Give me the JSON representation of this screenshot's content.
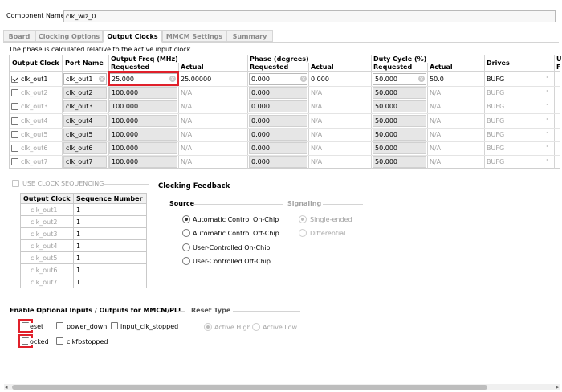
{
  "component": {
    "label": "Component Name",
    "value": "clk_wiz_0"
  },
  "tabs": [
    "Board",
    "Clocking Options",
    "Output Clocks",
    "MMCM Settings",
    "Summary"
  ],
  "active_tab": "Output Clocks",
  "phase_note": "The phase is calculated relative to the active input clock.",
  "table": {
    "headers": {
      "output_clock": "Output Clock",
      "port_name": "Port Name",
      "freq": "Output Freq (MHz)",
      "phase": "Phase (degrees)",
      "duty": "Duty Cycle (%)",
      "drives": "Drives",
      "u": "U",
      "f": "F",
      "requested": "Requested",
      "actual": "Actual"
    },
    "rows": [
      {
        "enabled": true,
        "name": "clk_out1",
        "port": "clk_out1",
        "freq_req": "25.000",
        "freq_act": "25.00000",
        "phase_req": "0.000",
        "phase_act": "0.000",
        "duty_req": "50.000",
        "duty_act": "50.0",
        "drives": "BUFG"
      },
      {
        "enabled": false,
        "name": "clk_out2",
        "port": "clk_out2",
        "freq_req": "100.000",
        "freq_act": "N/A",
        "phase_req": "0.000",
        "phase_act": "N/A",
        "duty_req": "50.000",
        "duty_act": "N/A",
        "drives": "BUFG"
      },
      {
        "enabled": false,
        "name": "clk_out3",
        "port": "clk_out3",
        "freq_req": "100.000",
        "freq_act": "N/A",
        "phase_req": "0.000",
        "phase_act": "N/A",
        "duty_req": "50.000",
        "duty_act": "N/A",
        "drives": "BUFG"
      },
      {
        "enabled": false,
        "name": "clk_out4",
        "port": "clk_out4",
        "freq_req": "100.000",
        "freq_act": "N/A",
        "phase_req": "0.000",
        "phase_act": "N/A",
        "duty_req": "50.000",
        "duty_act": "N/A",
        "drives": "BUFG"
      },
      {
        "enabled": false,
        "name": "clk_out5",
        "port": "clk_out5",
        "freq_req": "100.000",
        "freq_act": "N/A",
        "phase_req": "0.000",
        "phase_act": "N/A",
        "duty_req": "50.000",
        "duty_act": "N/A",
        "drives": "BUFG"
      },
      {
        "enabled": false,
        "name": "clk_out6",
        "port": "clk_out6",
        "freq_req": "100.000",
        "freq_act": "N/A",
        "phase_req": "0.000",
        "phase_act": "N/A",
        "duty_req": "50.000",
        "duty_act": "N/A",
        "drives": "BUFG"
      },
      {
        "enabled": false,
        "name": "clk_out7",
        "port": "clk_out7",
        "freq_req": "100.000",
        "freq_act": "N/A",
        "phase_req": "0.000",
        "phase_act": "N/A",
        "duty_req": "50.000",
        "duty_act": "N/A",
        "drives": "BUFG"
      }
    ]
  },
  "sequencing": {
    "label": "USE CLOCK SEQUENCING",
    "col_output": "Output Clock",
    "col_seq": "Sequence Number",
    "rows": [
      {
        "clock": "clk_out1",
        "seq": "1"
      },
      {
        "clock": "clk_out2",
        "seq": "1"
      },
      {
        "clock": "clk_out3",
        "seq": "1"
      },
      {
        "clock": "clk_out4",
        "seq": "1"
      },
      {
        "clock": "clk_out5",
        "seq": "1"
      },
      {
        "clock": "clk_out6",
        "seq": "1"
      },
      {
        "clock": "clk_out7",
        "seq": "1"
      }
    ]
  },
  "feedback": {
    "title": "Clocking Feedback",
    "source_label": "Source",
    "signaling_label": "Signaling",
    "sources": [
      "Automatic Control On-Chip",
      "Automatic Control Off-Chip",
      "User-Controlled On-Chip",
      "User-Controlled Off-Chip"
    ],
    "selected_source": 0,
    "signaling": [
      "Single-ended",
      "Differential"
    ],
    "selected_signaling": 0
  },
  "optional": {
    "title": "Enable Optional Inputs / Outputs for MMCM/PLL",
    "reset": "reset",
    "power_down": "power_down",
    "input_clk_stopped": "input_clk_stopped",
    "locked": "locked",
    "clkfbstopped": "clkfbstopped"
  },
  "reset_type": {
    "title": "Reset Type",
    "options": [
      "Active High",
      "Active Low"
    ],
    "selected": 0
  },
  "colors": {
    "highlight": "#e0202a",
    "disabled_fill": "#e6e6e6"
  }
}
